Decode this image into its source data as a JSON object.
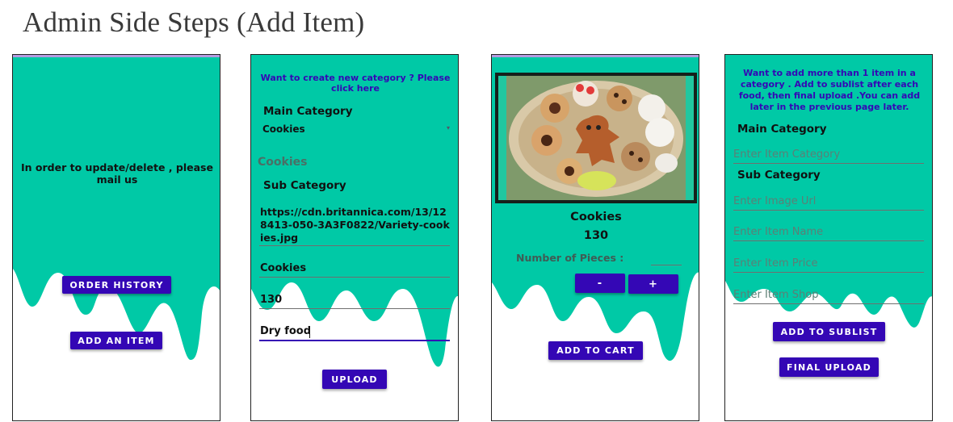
{
  "heading": "Admin Side Steps (Add Item)",
  "colors": {
    "teal": "#00c9a6",
    "button": "#3407b5",
    "link": "#3407b5"
  },
  "screen1": {
    "message": "In order to update/delete , please mail us",
    "order_history_button": "ORDER HISTORY",
    "add_item_button": "ADD AN ITEM"
  },
  "screen2": {
    "create_category_link": "Want to create new category ? Please click here",
    "main_category_label": "Main Category",
    "main_category_selected": "Cookies",
    "main_category_echo": "Cookies",
    "sub_category_label": "Sub Category",
    "image_url_value": "https://cdn.britannica.com/13/128413-050-3A3F0822/Variety-cookies.jpg",
    "name_value": "Cookies",
    "price_value": "130",
    "shop_value": "Dry food",
    "upload_button": "UPLOAD"
  },
  "screen3": {
    "image_icon": "cookies-photo",
    "product_name": "Cookies",
    "product_price": "130",
    "pieces_label": "Number of Pieces :",
    "minus_label": "-",
    "plus_label": "+",
    "add_to_cart_button": "ADD TO CART"
  },
  "screen4": {
    "info_text": "Want to add more than 1 item in a category . Add to sublist  after each food, then final upload .You can add later in the previous page later.",
    "main_category_label": "Main Category",
    "item_category_placeholder": "Enter Item Category",
    "sub_category_label": "Sub Category",
    "image_url_placeholder": "Enter Image Url",
    "item_name_placeholder": "Enter Item Name",
    "item_price_placeholder": "Enter Item Price",
    "item_shop_placeholder": "Enter Item Shop",
    "add_sublist_button": "ADD TO SUBLIST",
    "final_upload_button": "FINAL UPLOAD"
  }
}
